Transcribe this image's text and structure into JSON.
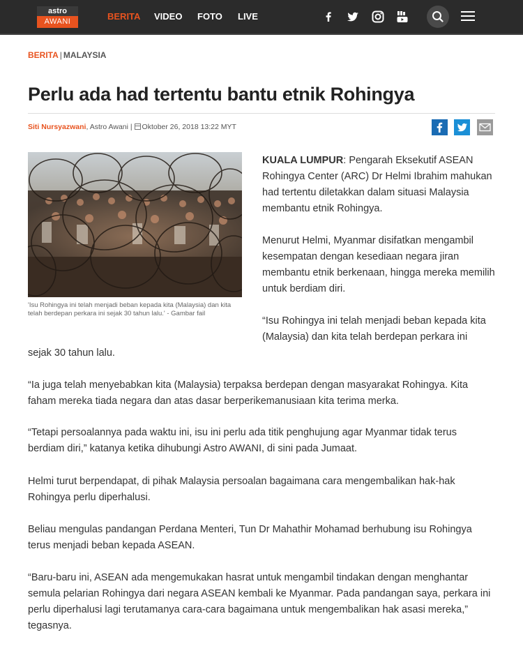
{
  "nav": {
    "logo_top": "astro",
    "logo_bottom": "AWANI",
    "links": [
      "BERITA",
      "VIDEO",
      "FOTO",
      "LIVE"
    ]
  },
  "icons": {
    "facebook": "facebook-icon",
    "twitter": "twitter-icon",
    "instagram": "instagram-icon",
    "youtube": "youtube-icon",
    "search": "search-icon",
    "menu": "hamburger-menu-icon",
    "share_facebook": "facebook-share-icon",
    "share_twitter": "twitter-share-icon",
    "share_email": "email-share-icon"
  },
  "colors": {
    "accent": "#e8531f",
    "nav_bg": "#2b2b2b"
  },
  "breadcrumb": {
    "section": "BERITA",
    "separator": "|",
    "subsection": "MALAYSIA"
  },
  "article": {
    "title": "Perlu ada had tertentu bantu etnik Rohingya",
    "author": "Siti Nursyazwani",
    "source": ", Astro Awani |",
    "date": "Oktober 26, 2018 13:22 MYT",
    "image_caption": "'Isu Rohingya ini telah menjadi beban kepada kita (Malaysia) dan kita telah berdepan perkara ini sejak 30 tahun lalu.' - Gambar fail",
    "dateline": "KUALA LUMPUR",
    "p1_rest": ": Pengarah Eksekutif ASEAN Rohingya Center (ARC) Dr Helmi Ibrahim mahukan had tertentu diletakkan dalam situasi Malaysia membantu etnik Rohingya.",
    "p2": "Menurut Helmi, Myanmar disifatkan mengambil kesempatan dengan kesediaan negara jiran membantu etnik berkenaan, hingga mereka memilih untuk berdiam diri.",
    "p3a": "“Isu Rohingya ini telah menjadi beban kepada kita (Malaysia) dan kita telah berdepan perkara ini",
    "p3b": "sejak 30 tahun lalu.",
    "p4": "“Ia juga telah menyebabkan kita (Malaysia) terpaksa berdepan dengan masyarakat Rohingya. Kita faham mereka tiada negara dan atas dasar berperikemanusiaan kita terima merka.",
    "p5": "“Tetapi persoalannya pada waktu ini, isu ini perlu ada titik penghujung agar Myanmar tidak terus berdiam diri,” katanya ketika dihubungi Astro AWANI, di sini pada Jumaat.",
    "p6": "Helmi turut berpendapat, di pihak Malaysia persoalan bagaimana cara mengembalikan hak-hak Rohingya perlu diperhalusi.",
    "p7": "Beliau mengulas pandangan Perdana Menteri, Tun Dr Mahathir Mohamad berhubung isu Rohingya terus menjadi beban kepada ASEAN.",
    "p8": "“Baru-baru ini, ASEAN ada mengemukakan hasrat untuk mengambil tindakan dengan menghantar semula pelarian Rohingya dari negara ASEAN kembali ke Myanmar. Pada pandangan saya, perkara ini perlu diperhalusi lagi terutamanya cara-cara bagaimana untuk mengembalikan hak asasi mereka,” tegasnya."
  }
}
